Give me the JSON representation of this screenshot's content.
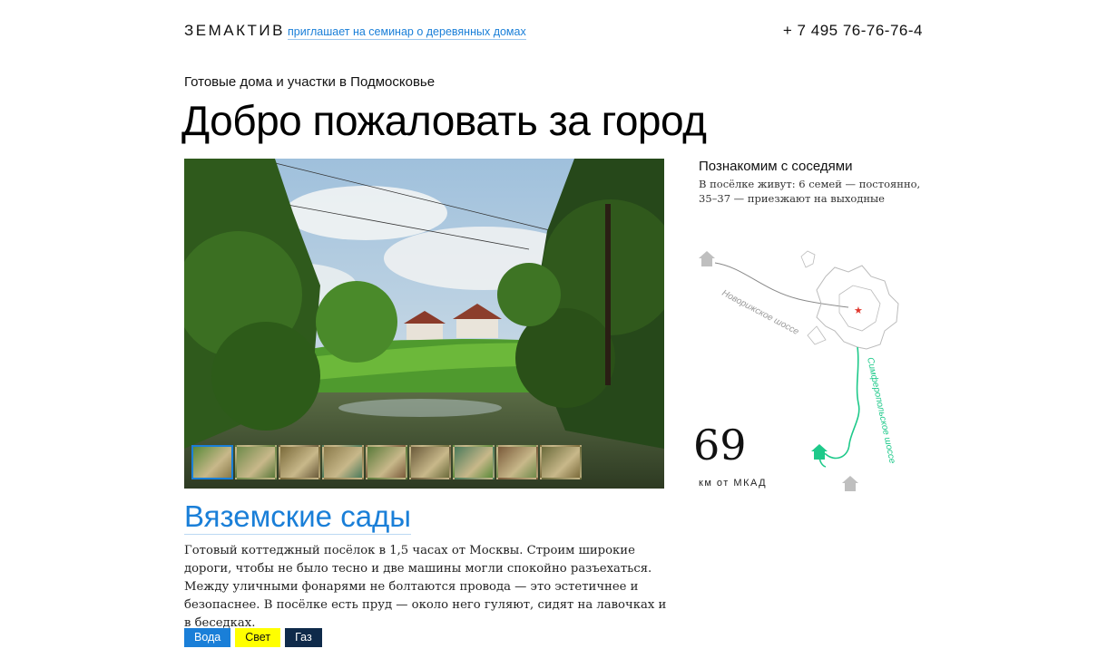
{
  "header": {
    "logo": "ЗЕМАКТИВ",
    "invite_link": "приглашает на семинар о деревянных домах",
    "phone": "+ 7 495 76-76-76-4"
  },
  "hero": {
    "subtitle": "Готовые дома и участки в Подмосковье",
    "title": "Добро пожаловать за город"
  },
  "gallery": {
    "thumbnail_count": 9,
    "active_index": 0
  },
  "village": {
    "name": "Вяземские сады",
    "description": "Готовый коттеджный посёлок в 1,5 часах от Москвы. Строим широкие дороги, чтобы не было тесно и две машины могли спокойно разъехаться. Между уличными фонарями не болтаются провода — это эстетичнее и безопаснее. В посёлке есть пруд — около него гуляют, сидят на лавочках и в беседках.",
    "amenities": [
      {
        "label": "Вода",
        "color": "#1a7fd8"
      },
      {
        "label": "Свет",
        "color": "#ffff00"
      },
      {
        "label": "Газ",
        "color": "#0f2a4a"
      }
    ]
  },
  "neighbors": {
    "title": "Познакомим с соседями",
    "text": "В посёлке живут: 6 семей — постоянно, 35–37 — приезжают на выходные"
  },
  "map": {
    "road_1": "Новорижское шоссе",
    "road_2": "Симферопольское шоссе",
    "distance_value": "69",
    "distance_label": "км от МКАД",
    "highlight_color": "#1ec98a"
  }
}
